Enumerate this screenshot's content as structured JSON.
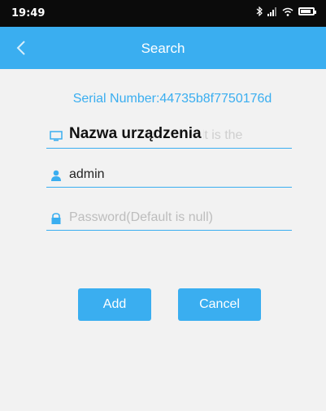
{
  "status_bar": {
    "time": "19:49",
    "icons": [
      "bluetooth-icon",
      "signal-icon",
      "wifi-icon",
      "battery-icon"
    ]
  },
  "header": {
    "title": "Search",
    "back_icon": "chevron-left-icon"
  },
  "serial": {
    "text": "Serial Number:44735b8f7750176d"
  },
  "form": {
    "device_name": {
      "value": "Nazwa urządzenia",
      "placeholder_fragment": "efault is the",
      "icon": "monitor-icon"
    },
    "username": {
      "value": "admin",
      "icon": "user-icon"
    },
    "password": {
      "placeholder": "Password(Default is null)",
      "icon": "lock-icon"
    }
  },
  "buttons": {
    "add": "Add",
    "cancel": "Cancel"
  },
  "colors": {
    "accent": "#3aaef0",
    "background": "#f2f2f2",
    "status_bar": "#0b0b0b"
  }
}
